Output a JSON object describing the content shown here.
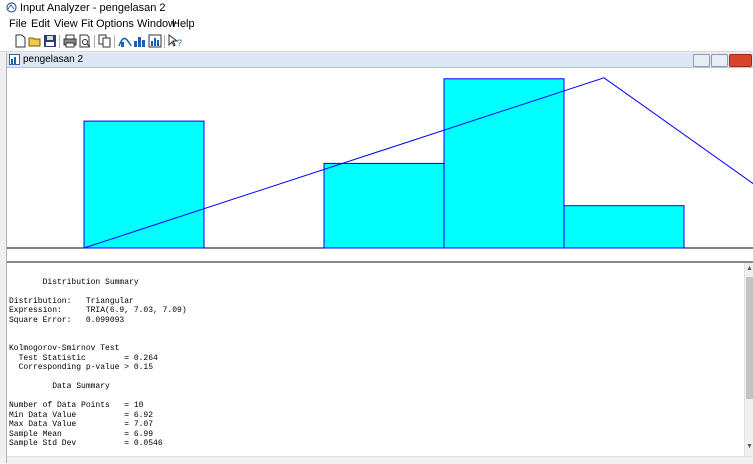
{
  "app": {
    "title": "Input Analyzer - pengelasan 2"
  },
  "menu": [
    "File",
    "Edit",
    "View",
    "Fit",
    "Options",
    "Window",
    "Help"
  ],
  "toolbar": [
    "new-icon",
    "open-icon",
    "save-icon",
    "print-icon",
    "print-preview-icon",
    "copy-icon",
    "fit-icon",
    "histogram-icon",
    "chart-options-icon",
    "help-icon"
  ],
  "child_window": {
    "title": "pengelasan 2"
  },
  "chart_data": {
    "type": "bar",
    "title": "",
    "xlabel": "",
    "ylabel": "",
    "bins": [
      {
        "start": 6.9,
        "end": 6.93,
        "count": 3
      },
      {
        "start": 6.93,
        "end": 6.96,
        "count": 0
      },
      {
        "start": 6.96,
        "end": 6.99,
        "count": 2
      },
      {
        "start": 6.99,
        "end": 7.02,
        "count": 4
      },
      {
        "start": 7.02,
        "end": 7.05,
        "count": 1
      }
    ],
    "fit": {
      "distribution": "Triangular",
      "min": 6.9,
      "mode": 7.03,
      "max": 7.09
    },
    "bar_color": "#00ffff",
    "line_color": "#0000ff",
    "grid": false
  },
  "summary_lines": [
    "",
    "       Distribution Summary",
    "",
    "Distribution:   Triangular",
    "Expression:     TRIA(6.9, 7.03, 7.09)",
    "Square Error:   0.099093",
    "",
    "",
    "Kolmogorov-Smirnov Test",
    "  Test Statistic        = 0.264",
    "  Corresponding p-value > 0.15",
    "",
    "         Data Summary",
    "",
    "Number of Data Points   = 10",
    "Min Data Value          = 6.92",
    "Max Data Value          = 7.07",
    "Sample Mean             = 6.99",
    "Sample Std Dev          = 0.0546"
  ]
}
